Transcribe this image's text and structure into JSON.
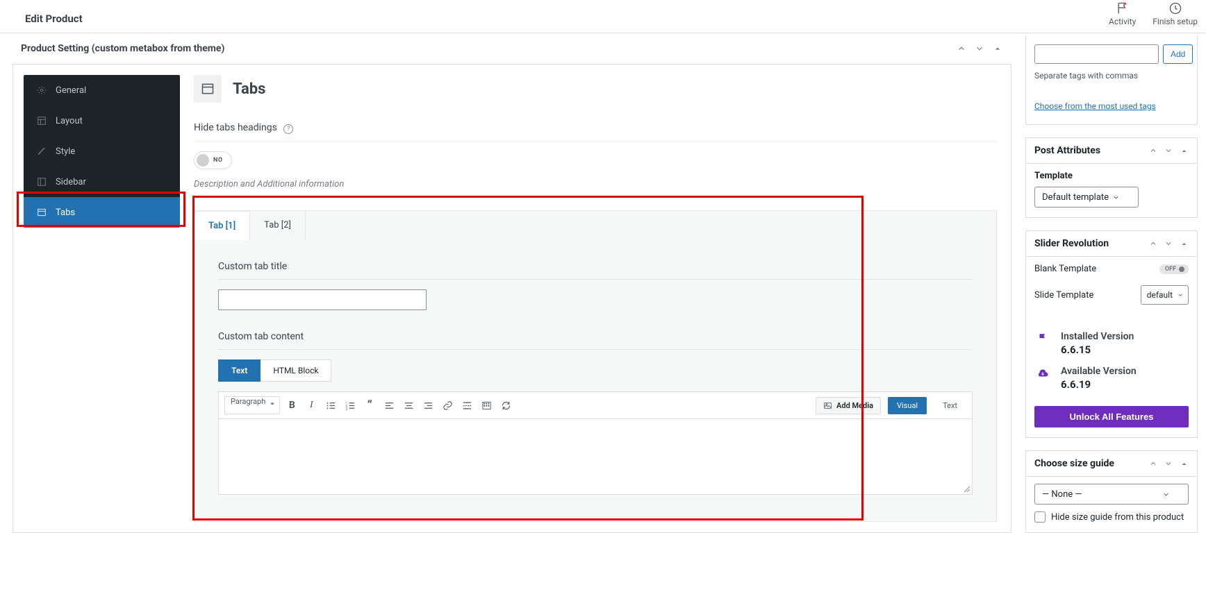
{
  "header": {
    "page_title": "Edit Product",
    "actions": {
      "activity": "Activity",
      "finish_setup": "Finish setup"
    }
  },
  "main_postbox": {
    "title": "Product Setting (custom metabox from theme)",
    "side_tabs": [
      "General",
      "Layout",
      "Style",
      "Sidebar",
      "Tabs"
    ],
    "active_index": 4,
    "screen_title": "Tabs",
    "hide_tabs_label": "Hide tabs headings",
    "toggle_label": "NO",
    "desc": "Description and Additional information",
    "tab_nav": [
      "Tab [1]",
      "Tab [2]"
    ],
    "fields": {
      "title_label": "Custom tab title",
      "content_label": "Custom tab content",
      "ed_mode": {
        "text": "Text",
        "html": "HTML Block"
      },
      "format_select": "Paragraph",
      "add_media": "Add Media",
      "visual": "Visual",
      "text_tab": "Text"
    }
  },
  "tags_box": {
    "add_btn": "Add",
    "help": "Separate tags with commas",
    "link": "Choose from the most used tags"
  },
  "post_attributes": {
    "title": "Post Attributes",
    "template_label": "Template",
    "template_value": "Default template"
  },
  "slider_revolution": {
    "title": "Slider Revolution",
    "blank_label": "Blank Template",
    "off": "OFF",
    "slide_label": "Slide Template",
    "slide_value": "default",
    "installed_label": "Installed Version",
    "installed_value": "6.6.15",
    "available_label": "Available Version",
    "available_value": "6.6.19",
    "unlock": "Unlock All Features"
  },
  "size_guide": {
    "title": "Choose size guide",
    "none": "— None —",
    "hide_label": "Hide size guide from this product"
  }
}
